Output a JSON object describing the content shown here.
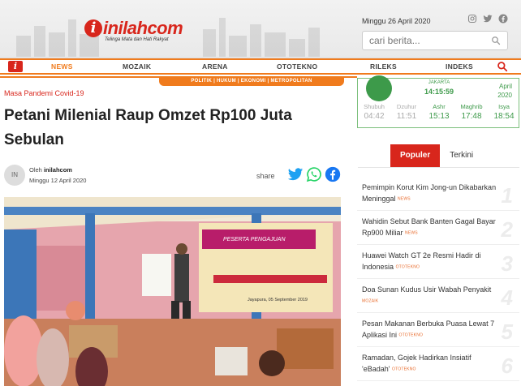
{
  "header": {
    "logo_letter": "i",
    "logo_text": "inilahcom",
    "tagline": "Telinga Mata dan Hati Rakyat",
    "date": "Minggu 26 April 2020",
    "search_placeholder": "cari berita..."
  },
  "nav": {
    "items": [
      "NEWS",
      "MOZAIK",
      "ARENA",
      "OTOTEKNO",
      "RILEKS",
      "INDEKS"
    ],
    "subnav": "POLITIK  |  HUKUM  |  EKONOMI  |  METROPOLITAN"
  },
  "article": {
    "category": "Masa Pandemi Covid-19",
    "title": "Petani Milenial Raup Omzet Rp100 Juta Sebulan",
    "author_prefix": "Oleh",
    "author": "inilahcom",
    "author_initials": "IN",
    "date": "Minggu 12 April 2020",
    "share_label": "share",
    "photo_banner": "PESERTA PENGAJUAN",
    "photo_date": "Jayapura, 05 September 2019"
  },
  "prayer": {
    "city": "JAKARTA",
    "time": "14:15:59",
    "month": "April",
    "year": "2020",
    "times": [
      {
        "name": "Shubuh",
        "time": "04:42",
        "dim": true
      },
      {
        "name": "Dzuhur",
        "time": "11:51",
        "dim": true
      },
      {
        "name": "Ashr",
        "time": "15:13",
        "dim": false
      },
      {
        "name": "Maghrib",
        "time": "17:48",
        "dim": false
      },
      {
        "name": "Isya",
        "time": "18:54",
        "dim": false
      }
    ]
  },
  "tabs": {
    "active": "Populer",
    "inactive": "Terkini"
  },
  "popular": [
    {
      "text": "Pemimpin Korut Kim Jong-un Dikabarkan Meninggal",
      "tag": "NEWS",
      "num": "1"
    },
    {
      "text": "Wahidin Sebut Bank Banten Gagal Bayar Rp900 Miliar",
      "tag": "NEWS",
      "num": "2"
    },
    {
      "text": "Huawei Watch GT 2e Resmi Hadir di Indonesia",
      "tag": "OTOTEKNO",
      "num": "3"
    },
    {
      "text": "Doa Sunan Kudus Usir Wabah Penyakit",
      "tag": "MOZAIK",
      "num": "4"
    },
    {
      "text": "Pesan Makanan Berbuka Puasa Lewat 7 Aplikasi Ini",
      "tag": "OTOTEKNO",
      "num": "5"
    },
    {
      "text": "Ramadan, Gojek Hadirkan Insiatif 'eBadah'",
      "tag": "OTOTEKNO",
      "num": "6"
    }
  ],
  "colors": {
    "brand_red": "#d8261c",
    "accent_orange": "#f07b1d",
    "prayer_green": "#3d9a4a"
  }
}
